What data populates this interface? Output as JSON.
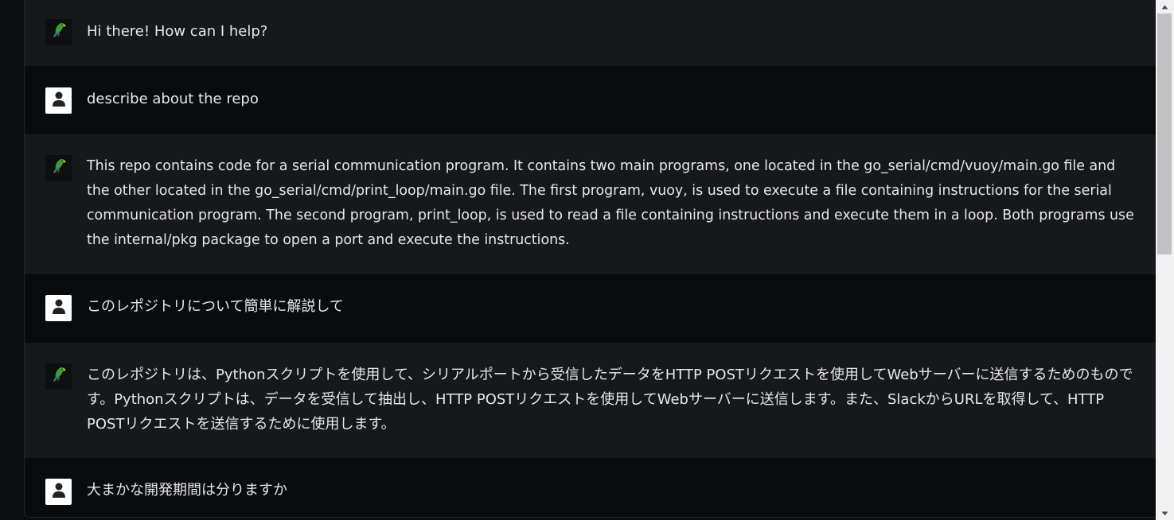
{
  "conversation": {
    "messages": [
      {
        "role": "bot",
        "avatar_icon": "parrot-icon",
        "text": "Hi there! How can I help?"
      },
      {
        "role": "user",
        "avatar_icon": "user-icon",
        "text": "describe about the repo"
      },
      {
        "role": "bot",
        "avatar_icon": "parrot-icon",
        "text": "This repo contains code for a serial communication program. It contains two main programs, one located in the go_serial/cmd/vuoy/main.go file and the other located in the go_serial/cmd/print_loop/main.go file. The first program, vuoy, is used to execute a file containing instructions for the serial communication program. The second program, print_loop, is used to read a file containing instructions and execute them in a loop. Both programs use the internal/pkg package to open a port and execute the instructions."
      },
      {
        "role": "user",
        "avatar_icon": "user-icon",
        "text": "このレポジトリについて簡単に解説して"
      },
      {
        "role": "bot",
        "avatar_icon": "parrot-icon",
        "text": "このレポジトリは、Pythonスクリプトを使用して、シリアルポートから受信したデータをHTTP POSTリクエストを使用してWebサーバーに送信するためのものです。Pythonスクリプトは、データを受信して抽出し、HTTP POSTリクエストを使用してWebサーバーに送信します。また、SlackからURLを取得して、HTTP POSTリクエストを送信するために使用します。"
      },
      {
        "role": "user",
        "avatar_icon": "user-icon",
        "text": "大まかな開発期間は分りますか"
      }
    ]
  },
  "colors": {
    "bot_row_bg": "#17181c",
    "user_row_bg": "#0a0b0d",
    "text": "#e6e7ea",
    "scrollbar_track": "#f1f1f1",
    "scrollbar_thumb": "#c1c1c1"
  }
}
